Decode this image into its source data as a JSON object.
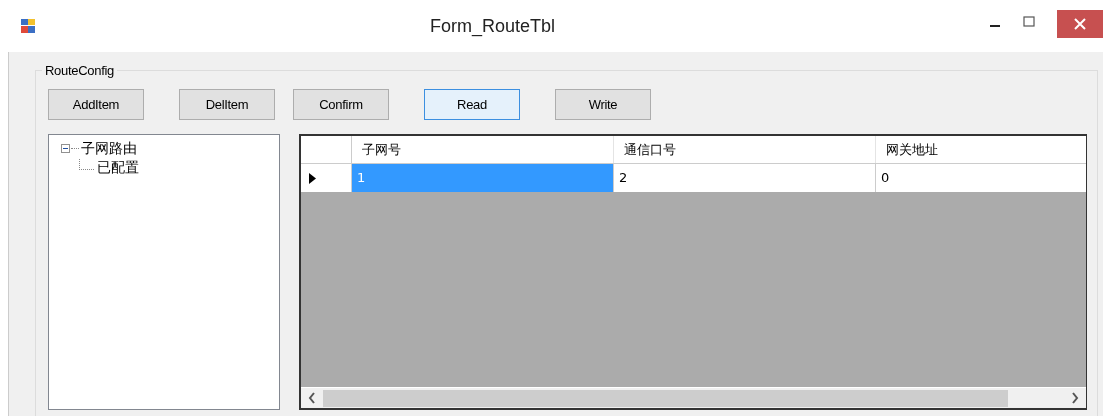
{
  "window": {
    "title": "Form_RouteTbl"
  },
  "group": {
    "title": "RouteConfig"
  },
  "buttons": [
    {
      "label": "AddItem",
      "focused": false
    },
    {
      "label": "DelItem",
      "focused": false
    },
    {
      "label": "Confirm",
      "focused": false
    },
    {
      "label": "Read",
      "focused": true
    },
    {
      "label": "Write",
      "focused": false
    }
  ],
  "tree": [
    {
      "label": "子网路由",
      "expanded": true,
      "children": [
        {
          "label": "已配置"
        }
      ]
    }
  ],
  "table": {
    "columns": [
      "子网号",
      "通信口号",
      "网关地址"
    ],
    "rows": [
      {
        "current": true,
        "cells": [
          {
            "text": "1",
            "selected": true
          },
          {
            "text": "2",
            "selected": false
          },
          {
            "text": "0",
            "selected": false
          }
        ]
      }
    ]
  }
}
